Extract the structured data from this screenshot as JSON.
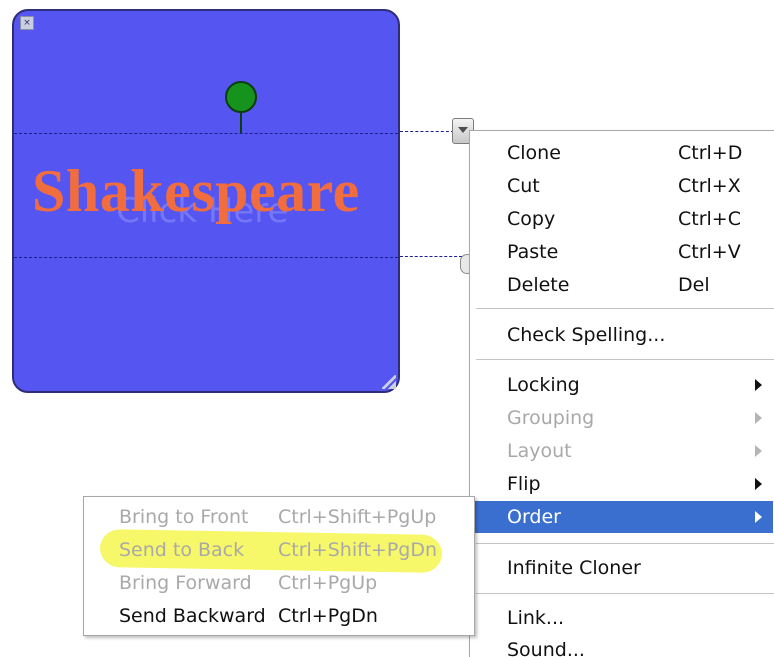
{
  "canvas_object": {
    "title": "Shakespeare",
    "placeholder": "Click Here",
    "background_color": "#5555f2",
    "title_color": "#f26d3d",
    "rotate_handle_color": "#16931d",
    "corner_icon": "close-icon"
  },
  "context_menu": {
    "items": [
      {
        "label": "Clone",
        "shortcut": "Ctrl+D"
      },
      {
        "label": "Cut",
        "shortcut": "Ctrl+X"
      },
      {
        "label": "Copy",
        "shortcut": "Ctrl+C"
      },
      {
        "label": "Paste",
        "shortcut": "Ctrl+V"
      },
      {
        "label": "Delete",
        "shortcut": "Del"
      },
      {
        "label": "Check Spelling..."
      },
      {
        "label": "Locking",
        "submenu": true
      },
      {
        "label": "Grouping",
        "submenu": true,
        "disabled": true
      },
      {
        "label": "Layout",
        "submenu": true,
        "disabled": true
      },
      {
        "label": "Flip",
        "submenu": true
      },
      {
        "label": "Order",
        "submenu": true,
        "highlighted": true
      },
      {
        "label": "Infinite Cloner"
      },
      {
        "label": "Link..."
      },
      {
        "label": "Sound..."
      }
    ],
    "highlight_color": "#3a6fd0"
  },
  "order_submenu": {
    "items": [
      {
        "label": "Bring to Front",
        "shortcut": "Ctrl+Shift+PgUp",
        "disabled": true
      },
      {
        "label": "Send to Back",
        "shortcut": "Ctrl+Shift+PgDn",
        "disabled": true,
        "marked": true
      },
      {
        "label": "Bring Forward",
        "shortcut": "Ctrl+PgUp",
        "disabled": true
      },
      {
        "label": "Send Backward",
        "shortcut": "Ctrl+PgDn"
      }
    ],
    "marker_color": "#f6f650"
  }
}
